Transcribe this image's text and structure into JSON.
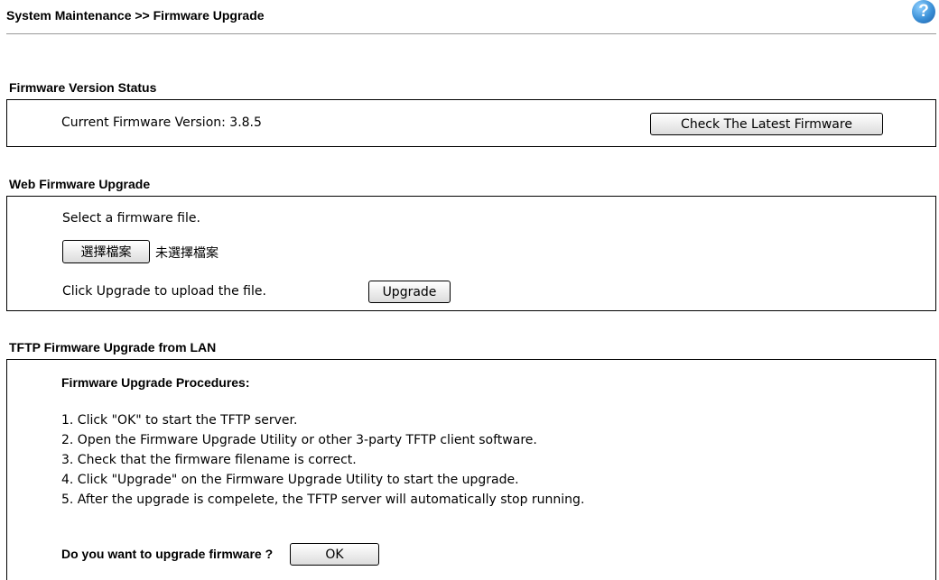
{
  "header": {
    "title": "System Maintenance >> Firmware Upgrade",
    "help_label": "?"
  },
  "firmware_status": {
    "section_title": "Firmware Version Status",
    "current_version_text": "Current Firmware Version: 3.8.5",
    "check_button_label": "Check The Latest Firmware"
  },
  "web_upgrade": {
    "section_title": "Web Firmware Upgrade",
    "select_text": "Select a firmware file.",
    "choose_file_button_label": "選擇檔案",
    "no_file_text": "未選擇檔案",
    "click_upgrade_text": "Click Upgrade to upload the file.",
    "upgrade_button_label": "Upgrade"
  },
  "tftp_upgrade": {
    "section_title": "TFTP Firmware Upgrade from LAN",
    "procedures_title": "Firmware Upgrade Procedures:",
    "procedures": [
      "1. Click \"OK\" to start the TFTP server.",
      "2. Open the Firmware Upgrade Utility or other 3-party TFTP client software.",
      "3. Check that the firmware filename is correct.",
      "4. Click \"Upgrade\" on the Firmware Upgrade Utility to start the upgrade.",
      "5. After the upgrade is compelete, the TFTP server will automatically stop running."
    ],
    "question_text": "Do you want to upgrade firmware ?",
    "ok_button_label": "OK"
  }
}
